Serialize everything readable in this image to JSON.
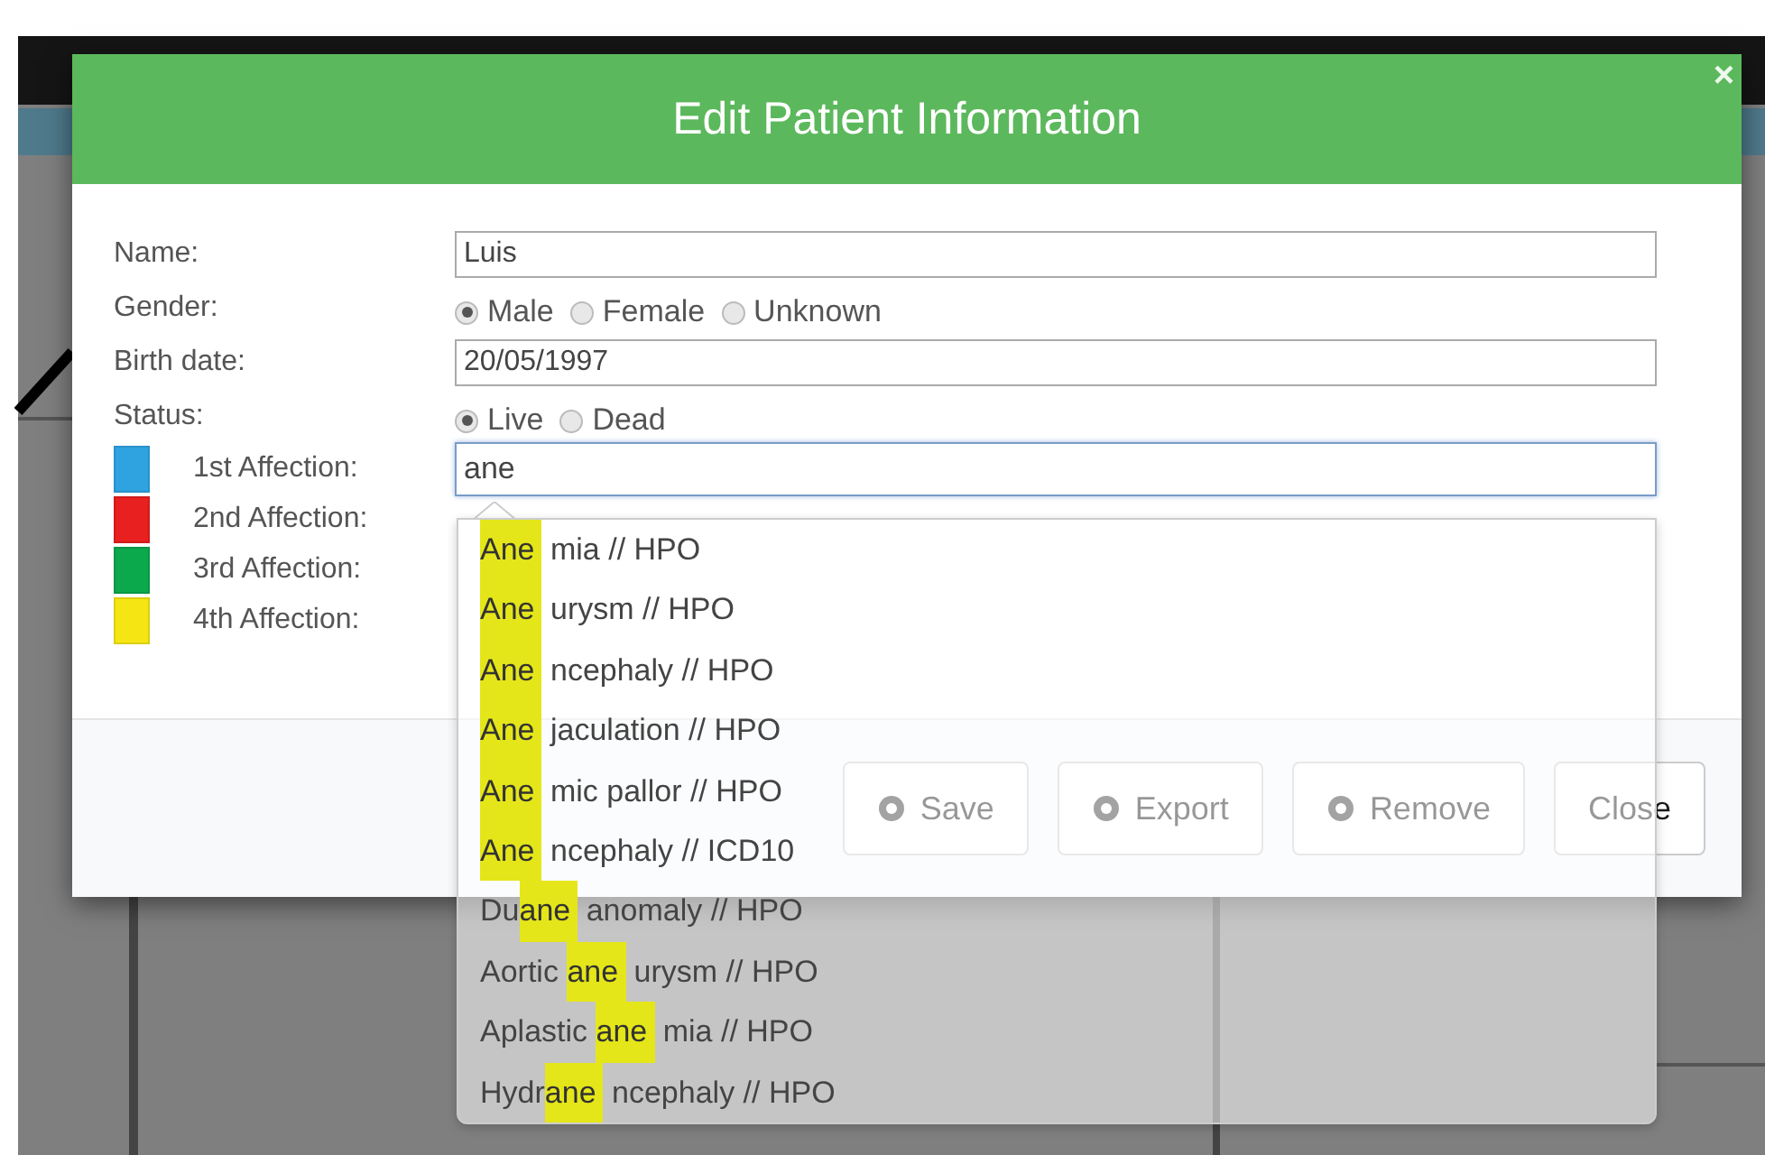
{
  "dialog": {
    "title": "Edit Patient Information",
    "close": "×"
  },
  "form": {
    "name": {
      "label": "Name:",
      "value": "Luis"
    },
    "gender": {
      "label": "Gender:",
      "options": [
        {
          "label": "Male",
          "selected": true
        },
        {
          "label": "Female",
          "selected": false
        },
        {
          "label": "Unknown",
          "selected": false
        }
      ]
    },
    "birth_date": {
      "label": "Birth date:",
      "value": "20/05/1997"
    },
    "status": {
      "label": "Status:",
      "options": [
        {
          "label": "Live",
          "selected": true
        },
        {
          "label": "Dead",
          "selected": false
        }
      ]
    },
    "affections": [
      {
        "label": "1st Affection:",
        "color": "#2ea3e0",
        "value": "ane"
      },
      {
        "label": "2nd Affection:",
        "color": "#e8201f"
      },
      {
        "label": "3rd Affection:",
        "color": "#0ba84c"
      },
      {
        "label": "4th Affection:",
        "color": "#f5e613"
      }
    ]
  },
  "buttons": [
    {
      "label": "Save",
      "icon": true
    },
    {
      "label": "Export",
      "icon": true
    },
    {
      "label": "Remove",
      "icon": true
    },
    {
      "label": "Close",
      "icon": false
    }
  ],
  "suggestions": [
    {
      "match": "Ane",
      "after": "mia // HPO"
    },
    {
      "match": "Ane",
      "after": "urysm // HPO"
    },
    {
      "match": "Ane",
      "after": "ncephaly // HPO"
    },
    {
      "match": "Ane",
      "after": "jaculation // HPO"
    },
    {
      "match": "Ane",
      "after": "mic pallor // HPO"
    },
    {
      "match": "Ane",
      "after": "ncephaly // ICD10"
    },
    {
      "before": "Du",
      "match": "ane",
      "after": "anomaly // HPO"
    },
    {
      "before": "Aortic ",
      "match": "ane",
      "after": "urysm // HPO"
    },
    {
      "before": "Aplastic ",
      "match": "ane",
      "after": "mia // HPO"
    },
    {
      "before": "Hydr",
      "match": "ane",
      "after": "ncephaly // HPO"
    }
  ]
}
